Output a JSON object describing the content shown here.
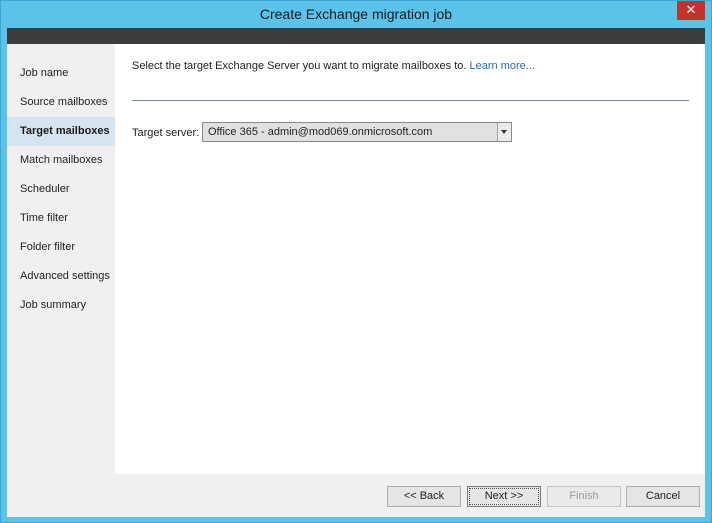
{
  "window": {
    "title": "Create Exchange migration job",
    "close_glyph": "✕"
  },
  "sidebar": {
    "items": [
      {
        "label": "Job name",
        "active": false
      },
      {
        "label": "Source mailboxes",
        "active": false
      },
      {
        "label": "Target mailboxes",
        "active": true
      },
      {
        "label": "Match mailboxes",
        "active": false
      },
      {
        "label": "Scheduler",
        "active": false
      },
      {
        "label": "Time filter",
        "active": false
      },
      {
        "label": "Folder filter",
        "active": false
      },
      {
        "label": "Advanced settings",
        "active": false
      },
      {
        "label": "Job summary",
        "active": false
      }
    ]
  },
  "main": {
    "instruction": "Select the target Exchange Server you want to migrate mailboxes to.",
    "learn_more": "Learn more...",
    "target_server_label": "Target server:",
    "target_server_value": "Office 365 - admin@mod069.onmicrosoft.com"
  },
  "footer": {
    "back_label": "<< Back",
    "next_label": "Next >>",
    "finish_label": "Finish",
    "cancel_label": "Cancel"
  },
  "icons": {
    "close": "close-icon",
    "dropdown": "chevron-down-icon"
  }
}
